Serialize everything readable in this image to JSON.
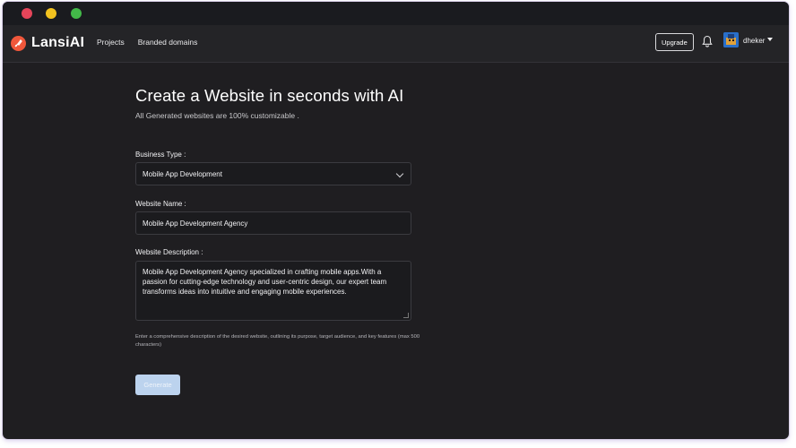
{
  "window": {
    "controls": [
      "close",
      "minimize",
      "maximize"
    ]
  },
  "navbar": {
    "brand": "LansiAI",
    "links": [
      "Projects",
      "Branded domains"
    ],
    "upgrade_label": "Upgrade",
    "notification_icon": "bell-icon",
    "user_name": "dheker"
  },
  "main": {
    "title": "Create a Website in seconds with AI",
    "subtitle": "All Generated websites are 100% customizable .",
    "business_type": {
      "label": "Business Type :",
      "selected": "Mobile App Development"
    },
    "website_name": {
      "label": "Website Name :",
      "value": "Mobile App Development Agency"
    },
    "website_description": {
      "label": "Website Description :",
      "value": "Mobile App Development Agency specialized in crafting mobile apps.With a passion for cutting-edge technology and user-centric design, our expert team transforms ideas into intuitive and engaging mobile experiences.",
      "hint": "Enter a comprehensive description of the desired website, outlining its purpose, target audience, and key features (max 500 characters)"
    },
    "generate_label": "Generate"
  },
  "colors": {
    "background": "#1f1e21",
    "brand": "#f0573b",
    "button_disabled": "#bcd3ee"
  }
}
